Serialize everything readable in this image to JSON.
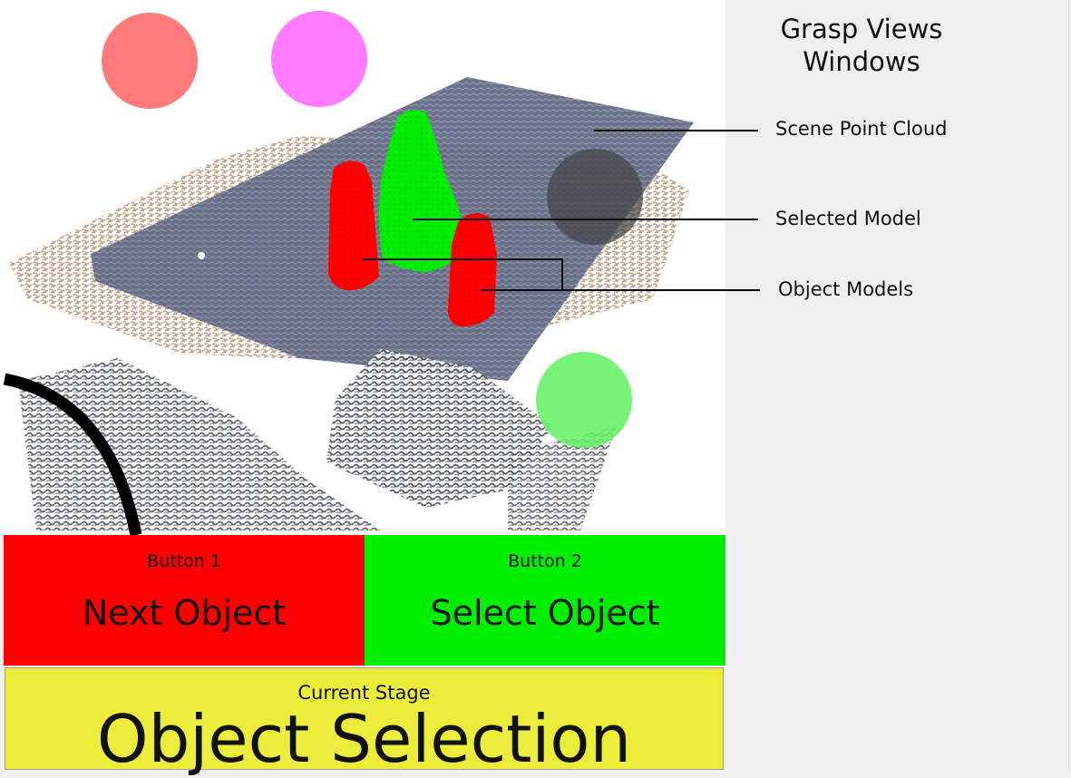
{
  "side_panel": {
    "title": "Grasp Views\nWindows"
  },
  "annotations": {
    "scene_point_cloud": "Scene Point Cloud",
    "selected_model": "Selected Model",
    "object_models": "Object Models"
  },
  "buttons": [
    {
      "small_label": "Button 1",
      "label": "Next Object",
      "color": "#ff0000"
    },
    {
      "small_label": "Button 2",
      "label": "Select Object",
      "color": "#00ee00"
    }
  ],
  "stage": {
    "small_label": "Current Stage",
    "label": "Object Selection",
    "color": "#ecec3a"
  },
  "scene_colors": {
    "red_indicator": "#ff7b7b",
    "magenta_indicator": "#ff7bff",
    "green_indicator": "#66f066",
    "dark_indicator": "#444444",
    "table_plane": "#5c6785",
    "selected_model": "#00ee00",
    "object_model": "#ff0000"
  }
}
